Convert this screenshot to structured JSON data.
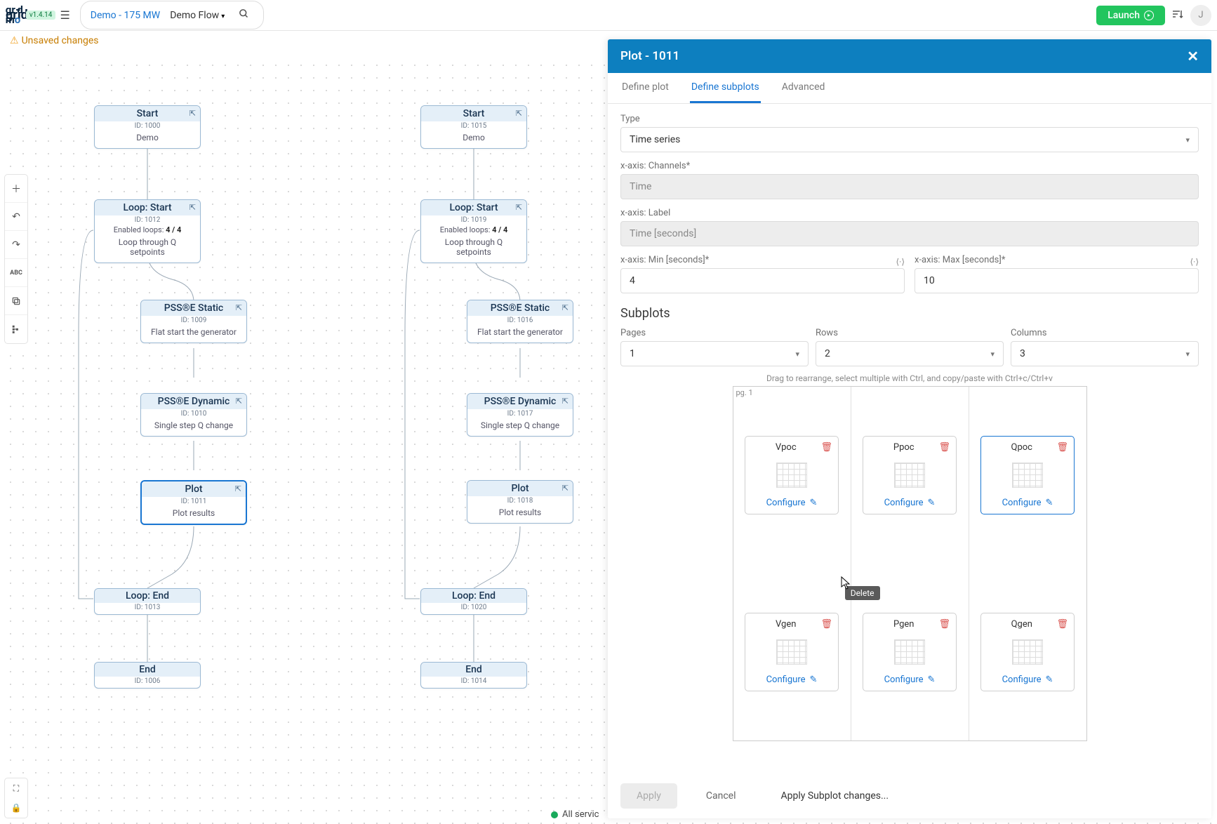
{
  "header": {
    "logo_text": "grid mo",
    "version": "v1.4.14",
    "project": "Demo - 175 MW",
    "flow": "Demo Flow",
    "launch_label": "Launch",
    "avatar_initial": "J"
  },
  "unsaved_banner": "Unsaved changes",
  "status_text": "All servic",
  "flows": {
    "left": {
      "start": {
        "title": "Start",
        "id": "ID: 1000",
        "body": "Demo"
      },
      "loopstart": {
        "title": "Loop: Start",
        "id": "ID: 1012",
        "loops_label": "Enabled loops:",
        "loops": "4 / 4",
        "body": "Loop through Q setpoints"
      },
      "static": {
        "title": "PSS®E Static",
        "id": "ID: 1009",
        "body": "Flat start the generator"
      },
      "dynamic": {
        "title": "PSS®E Dynamic",
        "id": "ID: 1010",
        "body": "Single step Q change"
      },
      "plot": {
        "title": "Plot",
        "id": "ID: 1011",
        "body": "Plot results"
      },
      "loopend": {
        "title": "Loop: End",
        "id": "ID: 1013"
      },
      "end": {
        "title": "End",
        "id": "ID: 1006"
      }
    },
    "right": {
      "start": {
        "title": "Start",
        "id": "ID: 1015",
        "body": "Demo"
      },
      "loopstart": {
        "title": "Loop: Start",
        "id": "ID: 1019",
        "loops_label": "Enabled loops:",
        "loops": "4 / 4",
        "body": "Loop through Q setpoints"
      },
      "static": {
        "title": "PSS®E Static",
        "id": "ID: 1016",
        "body": "Flat start the generator"
      },
      "dynamic": {
        "title": "PSS®E Dynamic",
        "id": "ID: 1017",
        "body": "Single step Q change"
      },
      "plot": {
        "title": "Plot",
        "id": "ID: 1018",
        "body": "Plot results"
      },
      "loopend": {
        "title": "Loop: End",
        "id": "ID: 1020"
      },
      "end": {
        "title": "End",
        "id": "ID: 1014"
      }
    }
  },
  "panel": {
    "title": "Plot - 1011",
    "tabs": {
      "define_plot": "Define plot",
      "define_subplots": "Define subplots",
      "advanced": "Advanced"
    },
    "type_label": "Type",
    "type_value": "Time series",
    "xchannels_label": "x-axis: Channels*",
    "xchannels_value": "Time",
    "xlabel_label": "x-axis: Label",
    "xlabel_value": "Time [seconds]",
    "xmin_label": "x-axis: Min [seconds]*",
    "xmin_value": "4",
    "xmax_label": "x-axis: Max [seconds]*",
    "xmax_value": "10",
    "subplots_title": "Subplots",
    "pages_label": "Pages",
    "pages_value": "1",
    "rows_label": "Rows",
    "rows_value": "2",
    "cols_label": "Columns",
    "cols_value": "3",
    "helper": "Drag to rearrange, select multiple with Ctrl, and copy/paste with Ctrl+c/Ctrl+v",
    "pg_label": "pg. 1",
    "configure_label": "Configure",
    "subplots": {
      "r0c0": "Vpoc",
      "r0c1": "Ppoc",
      "r0c2": "Qpoc",
      "r1c0": "Vgen",
      "r1c1": "Pgen",
      "r1c2": "Qgen"
    },
    "tooltip_delete": "Delete",
    "footer": {
      "apply": "Apply",
      "cancel": "Cancel",
      "apply_subplot": "Apply Subplot changes..."
    }
  }
}
